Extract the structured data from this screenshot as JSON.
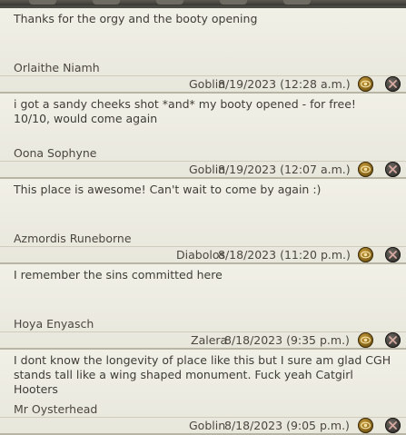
{
  "comments": [
    {
      "text": "Thanks for the orgy and the booty opening",
      "author": "Orlaithe Niamh",
      "world": "Goblin",
      "datetime": "8/19/2023 (12:28 a.m.)",
      "view_icon": "eye-icon",
      "remove_icon": "close-icon"
    },
    {
      "text": "i got a sandy cheeks shot *and* my booty opened - for free! 10/10, would come again",
      "author": "Oona Sophyne",
      "world": "Goblin",
      "datetime": "8/19/2023 (12:07 a.m.)",
      "view_icon": "eye-icon",
      "remove_icon": "close-icon"
    },
    {
      "text": "This place is awesome! Can't wait to come by again :)",
      "author": "Azmordis Runeborne",
      "world": "Diabolos",
      "datetime": "8/18/2023 (11:20 p.m.)",
      "view_icon": "eye-icon",
      "remove_icon": "close-icon"
    },
    {
      "text": "I remember the sins committed here",
      "author": "Hoya Enyasch",
      "world": "Zalera",
      "datetime": "8/18/2023 (9:35 p.m.)",
      "view_icon": "eye-icon",
      "remove_icon": "close-icon"
    },
    {
      "text": "I dont know the longevity of place like this but I sure am glad CGH stands tall like a wing shaped monument. Fuck yeah Catgirl Hooters",
      "author": "Mr Oysterhead",
      "world": "Goblin",
      "datetime": "8/18/2023 (9:05 p.m.)",
      "view_icon": "eye-icon",
      "remove_icon": "close-icon"
    }
  ],
  "colors": {
    "panel": "#f1f0e7",
    "text": "#3e3c36",
    "gold_button": "#c79a3a",
    "close_button": "#3a3733"
  }
}
